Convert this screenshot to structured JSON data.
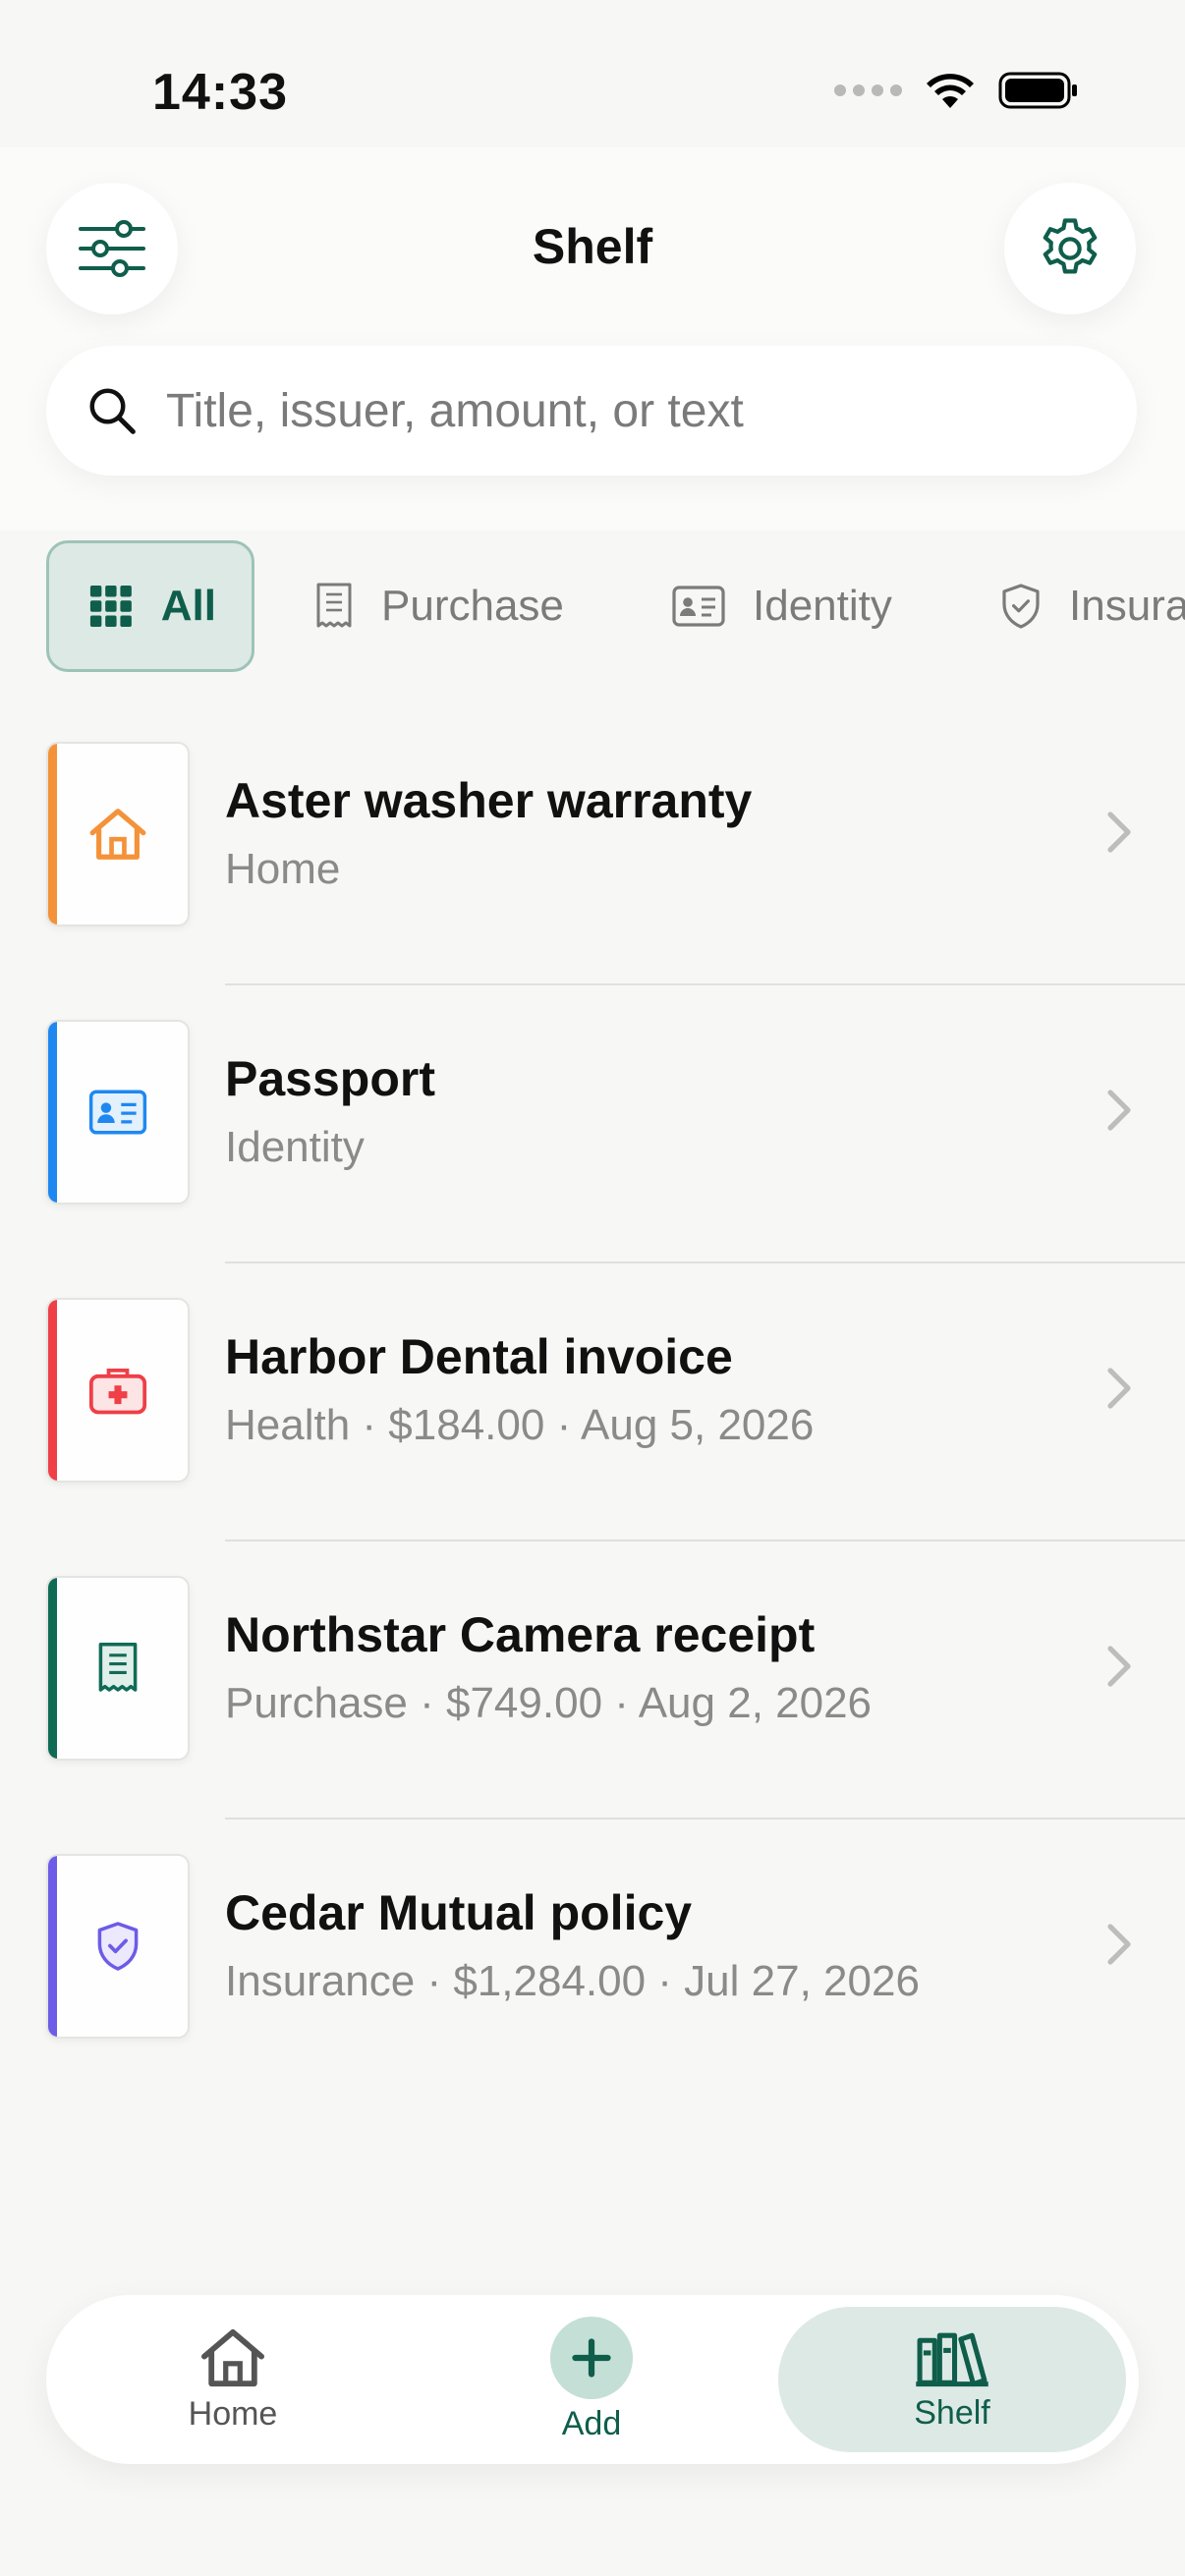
{
  "status_bar": {
    "time": "14:33"
  },
  "header": {
    "title": "Shelf",
    "filter_icon": "sliders-icon",
    "settings_icon": "gear-icon"
  },
  "search": {
    "placeholder": "Title, issuer, amount, or text"
  },
  "filter_tabs": [
    {
      "label": "All",
      "icon": "grid-icon",
      "selected": true
    },
    {
      "label": "Purchase",
      "icon": "receipt-icon",
      "selected": false
    },
    {
      "label": "Identity",
      "icon": "id-card-icon",
      "selected": false
    },
    {
      "label": "Insura",
      "icon": "shield-icon",
      "selected": false
    }
  ],
  "documents": [
    {
      "title": "Aster washer warranty",
      "subtitle": "Home",
      "icon": "house-icon",
      "color": "#f4923a"
    },
    {
      "title": "Passport",
      "subtitle": "Identity",
      "icon": "id-card-icon",
      "color": "#1e88f0"
    },
    {
      "title": "Harbor Dental invoice",
      "subtitle": "Health · $184.00 · Aug 5, 2026",
      "icon": "medical-kit-icon",
      "color": "#ef3f47"
    },
    {
      "title": "Northstar Camera receipt",
      "subtitle": "Purchase · $749.00 · Aug 2, 2026",
      "icon": "receipt-icon",
      "color": "#0f6b55"
    },
    {
      "title": "Cedar Mutual policy",
      "subtitle": "Insurance · $1,284.00 · Jul 27, 2026",
      "icon": "shield-check-icon",
      "color": "#6c5ce7"
    }
  ],
  "tab_bar": {
    "home": "Home",
    "add": "Add",
    "shelf": "Shelf"
  },
  "colors": {
    "accent": "#0f5e4b",
    "accent_bg": "#dde9e5"
  }
}
